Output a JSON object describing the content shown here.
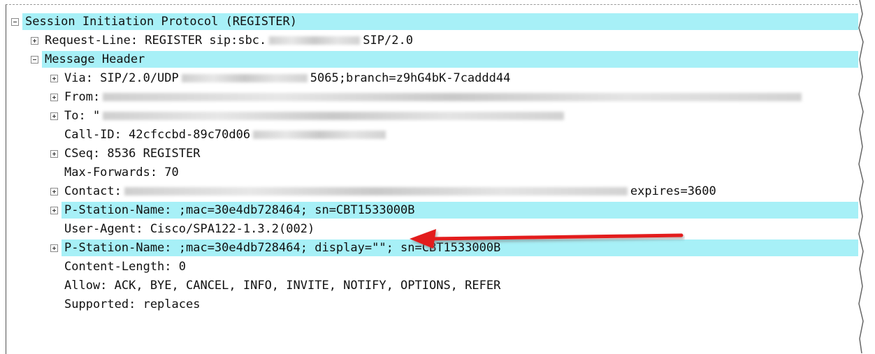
{
  "tree": {
    "root": "Session Initiation Protocol (REGISTER)",
    "request_line": {
      "prefix": "Request-Line: REGISTER sip:sbc.",
      "suffix": "SIP/2.0"
    },
    "message_header": "Message Header",
    "via": {
      "prefix": "Via: SIP/2.0/UDP",
      "suffix": "5065;branch=z9hG4bK-7caddd44"
    },
    "from": "From:",
    "to": "To: \"",
    "call_id": "Call-ID: 42cfccbd-89c70d06",
    "cseq": "CSeq: 8536 REGISTER",
    "max_forwards": "Max-Forwards: 70",
    "contact": {
      "prefix": "Contact:",
      "suffix": "expires=3600"
    },
    "p_station_1": "P-Station-Name: ;mac=30e4db728464; sn=CBT1533000B",
    "user_agent": "User-Agent: Cisco/SPA122-1.3.2(002)",
    "p_station_2": "P-Station-Name:  ;mac=30e4db728464; display=\"\"; sn=CBT1533000B",
    "content_length": "Content-Length: 0",
    "allow": "Allow: ACK, BYE, CANCEL, INFO, INVITE, NOTIFY, OPTIONS, REFER",
    "supported": "Supported: replaces"
  },
  "colors": {
    "highlight": "#a7f0f7",
    "arrow": "#e31b1b"
  }
}
